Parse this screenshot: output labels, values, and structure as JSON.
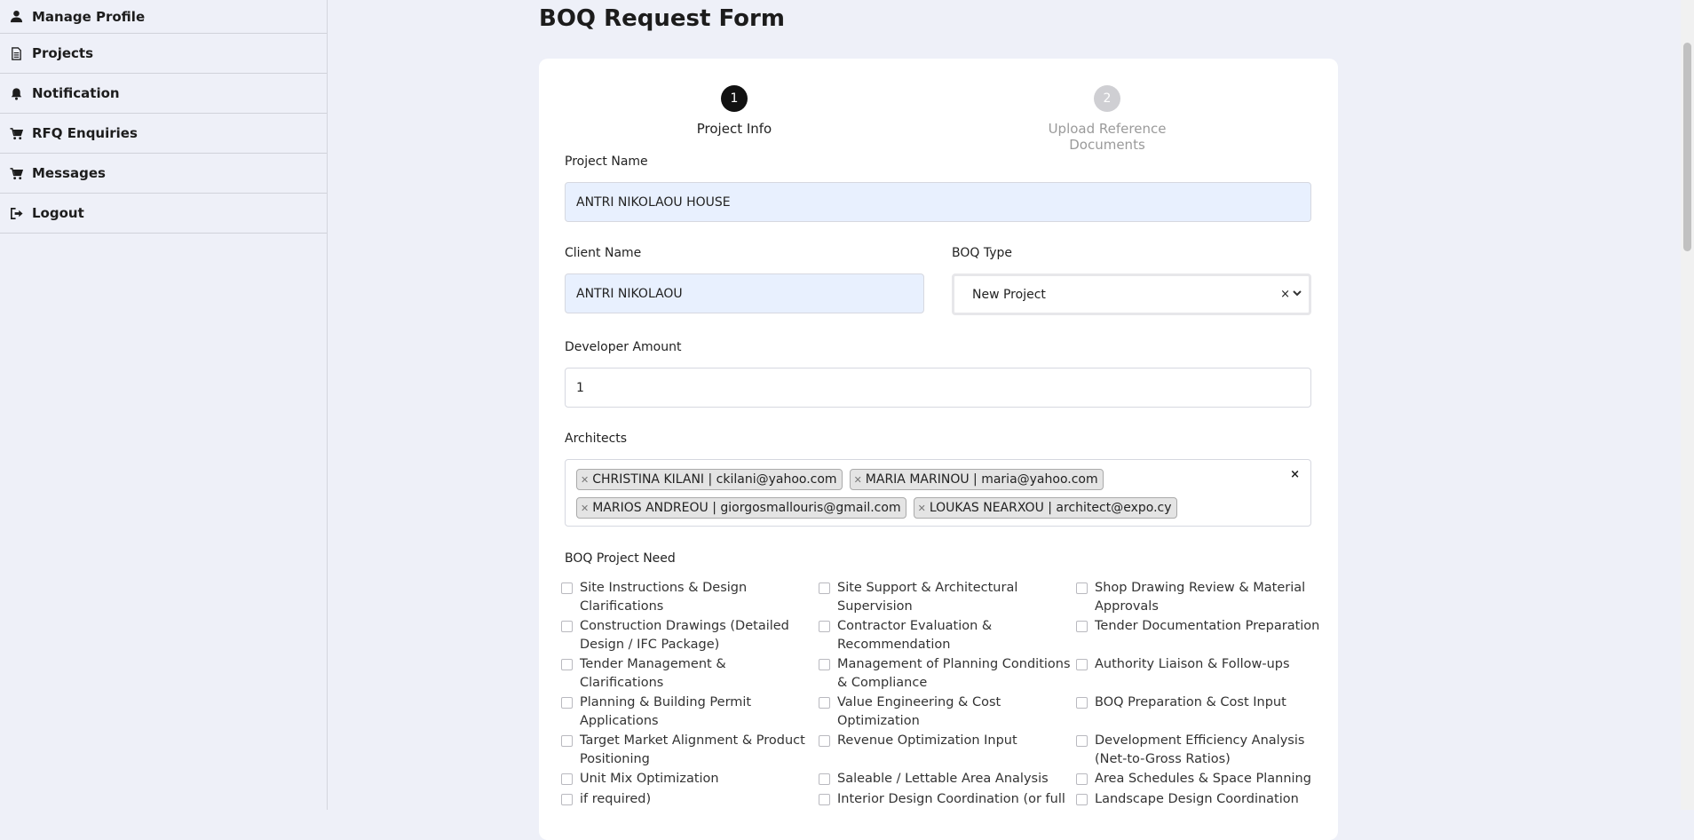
{
  "sidebar": {
    "items": [
      {
        "label": "Manage Profile",
        "icon": "user-icon"
      },
      {
        "label": "Projects",
        "icon": "document-icon"
      },
      {
        "label": "Notification",
        "icon": "bell-icon"
      },
      {
        "label": "RFQ Enquiries",
        "icon": "cart-icon"
      },
      {
        "label": "Messages",
        "icon": "cart-icon"
      },
      {
        "label": "Logout",
        "icon": "logout-icon"
      }
    ]
  },
  "page": {
    "title": "BOQ Request Form"
  },
  "steps": [
    {
      "number": "1",
      "label": "Project Info",
      "state": "active"
    },
    {
      "number": "2",
      "label": "Upload Reference Documents",
      "state": "inactive"
    }
  ],
  "form": {
    "project_name": {
      "label": "Project Name",
      "value": "ANTRI NIKOLAOU HOUSE"
    },
    "client_name": {
      "label": "Client Name",
      "value": "ANTRI NIKOLAOU"
    },
    "boq_type": {
      "label": "BOQ Type",
      "value": "New Project",
      "clear": "×"
    },
    "developer_amount": {
      "label": "Developer Amount",
      "value": "1"
    },
    "architects": {
      "label": "Architects",
      "clear": "×",
      "tags": [
        "CHRISTINA KILANI | ckilani@yahoo.com",
        "MARIA MARINOU | maria@yahoo.com",
        "MARIOS ANDREOU | giorgosmallouris@gmail.com",
        "LOUKAS NEARXOU | architect@expo.cy"
      ]
    },
    "project_need": {
      "label": "BOQ Project Need",
      "options": [
        "Site Instructions & Design Clarifications",
        "Site Support & Architectural Supervision",
        "Shop Drawing Review & Material Approvals",
        "Construction Drawings (Detailed Design / IFC Package)",
        "Contractor Evaluation & Recommendation",
        "Tender Documentation Preparation",
        "Tender Management & Clarifications",
        "Management of Planning Conditions & Compliance",
        "Authority Liaison & Follow-ups",
        "Planning & Building Permit Applications",
        "Value Engineering & Cost Optimization",
        "BOQ Preparation & Cost Input",
        "Target Market Alignment & Product Positioning",
        "Revenue Optimization Input",
        "Development Efficiency Analysis (Net-to-Gross Ratios)",
        "Unit Mix Optimization",
        "Saleable / Lettable Area Analysis",
        "Area Schedules & Space Planning",
        "if required)",
        "Interior Design Coordination (or full",
        "Landscape Design Coordination"
      ]
    }
  },
  "colors": {
    "background": "#eef0f8",
    "active_step": "#111111",
    "inactive_step": "#cfcfd3",
    "filled_input": "#e8f0fe"
  }
}
